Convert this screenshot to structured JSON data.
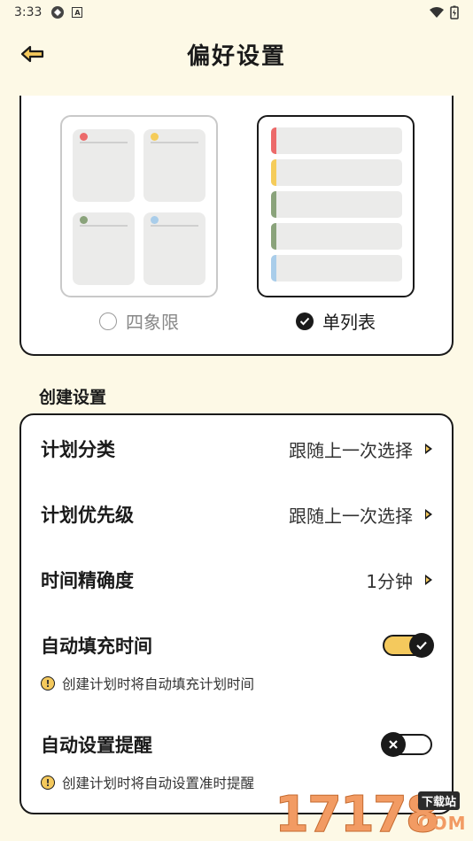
{
  "status_bar": {
    "time": "3:33"
  },
  "header": {
    "title": "偏好设置"
  },
  "layout_card": {
    "options": [
      {
        "label": "四象限",
        "selected": false
      },
      {
        "label": "单列表",
        "selected": true
      }
    ]
  },
  "create_section": {
    "title": "创建设置",
    "rows": [
      {
        "label": "计划分类",
        "value": "跟随上一次选择"
      },
      {
        "label": "计划优先级",
        "value": "跟随上一次选择"
      },
      {
        "label": "时间精确度",
        "value": "1分钟"
      }
    ],
    "toggles": [
      {
        "label": "自动填充时间",
        "hint": "创建计划时将自动填充计划时间",
        "on": true
      },
      {
        "label": "自动设置提醒",
        "hint": "创建计划时将自动设置准时提醒",
        "on": false
      }
    ]
  },
  "watermark": {
    "number": "17178",
    "site": "下载站",
    "domain": "COM"
  },
  "colors": {
    "accent_yellow": "#f4c95d",
    "red": "#ec6a6a",
    "yellow": "#f5cc5a",
    "green": "#8aa37b",
    "blue": "#a9cdea"
  }
}
